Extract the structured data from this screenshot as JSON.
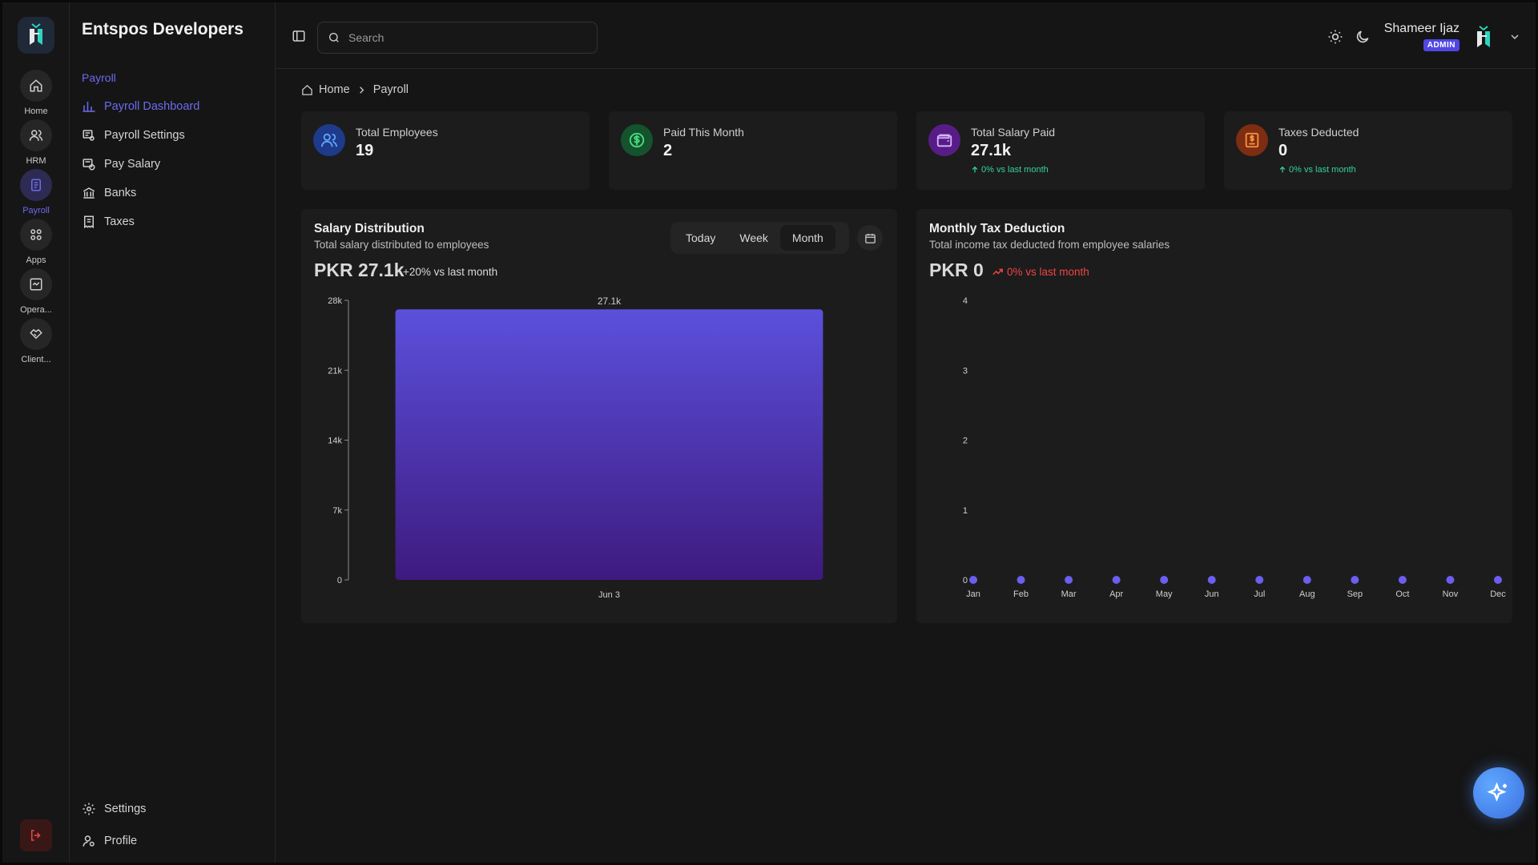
{
  "rail": {
    "items": [
      {
        "label": "Home",
        "icon": "home-icon"
      },
      {
        "label": "HRM",
        "icon": "users-icon"
      },
      {
        "label": "Payroll",
        "icon": "clipboard-icon"
      },
      {
        "label": "Apps",
        "icon": "grid-icon"
      },
      {
        "label": "Opera...",
        "icon": "operations-icon"
      },
      {
        "label": "Client...",
        "icon": "handshake-icon"
      }
    ]
  },
  "sidebar": {
    "org_name": "Entspos Developers",
    "section": "Payroll",
    "items": [
      {
        "label": "Payroll Dashboard",
        "icon": "bar-chart-icon"
      },
      {
        "label": "Payroll Settings",
        "icon": "settings-list-icon"
      },
      {
        "label": "Pay Salary",
        "icon": "pay-icon"
      },
      {
        "label": "Banks",
        "icon": "bank-icon"
      },
      {
        "label": "Taxes",
        "icon": "receipt-icon"
      }
    ],
    "footer": [
      {
        "label": "Settings",
        "icon": "gear-icon"
      },
      {
        "label": "Profile",
        "icon": "user-icon"
      }
    ]
  },
  "header": {
    "search_placeholder": "Search",
    "user_name": "Shameer Ijaz",
    "user_role": "ADMIN"
  },
  "breadcrumb": {
    "home": "Home",
    "current": "Payroll"
  },
  "stats": [
    {
      "label": "Total Employees",
      "value": "19",
      "trend": "",
      "color": "#3b82f6",
      "bg": "#1e3a8a",
      "icon": "users-icon"
    },
    {
      "label": "Paid This Month",
      "value": "2",
      "trend": "",
      "color": "#22c55e",
      "bg": "#14532d",
      "icon": "dollar-circle-icon"
    },
    {
      "label": "Total Salary Paid",
      "value": "27.1k",
      "trend": "0% vs last month",
      "color": "#c084fc",
      "bg": "#581c87",
      "icon": "wallet-icon"
    },
    {
      "label": "Taxes Deducted",
      "value": "0",
      "trend": "0% vs last month",
      "color": "#fb923c",
      "bg": "#7c2d12",
      "icon": "tax-doc-icon"
    }
  ],
  "salary": {
    "title": "Salary Distribution",
    "subtitle": "Total salary distributed to employees",
    "amount": "PKR 27.1k",
    "trend": "+20% vs last month",
    "ranges": [
      "Today",
      "Week",
      "Month"
    ],
    "active_range": "Month"
  },
  "tax": {
    "title": "Monthly Tax Deduction",
    "subtitle": "Total income tax deducted from employee salaries",
    "amount": "PKR 0",
    "trend": "0% vs last month",
    "trend_color": "#ef4444"
  },
  "chart_data": [
    {
      "type": "bar",
      "categories": [
        "Jun 3"
      ],
      "values": [
        27100
      ],
      "value_labels": [
        "27.1k"
      ],
      "ylim": [
        0,
        28000
      ],
      "yticks": [
        0,
        7000,
        14000,
        21000,
        28000
      ],
      "ytick_labels": [
        "0",
        "7k",
        "14k",
        "21k",
        "28k"
      ],
      "gradient": [
        "#5b50dc",
        "#3e1a7f"
      ]
    },
    {
      "type": "scatter",
      "categories": [
        "Jan",
        "Feb",
        "Mar",
        "Apr",
        "May",
        "Jun",
        "Jul",
        "Aug",
        "Sep",
        "Oct",
        "Nov",
        "Dec"
      ],
      "values": [
        0,
        0,
        0,
        0,
        0,
        0,
        0,
        0,
        0,
        0,
        0,
        0
      ],
      "ylim": [
        0,
        4
      ],
      "yticks": [
        0,
        1,
        2,
        3,
        4
      ],
      "ytick_labels": [
        "0",
        "1",
        "2",
        "3",
        "4"
      ],
      "color": "#6d5df0"
    }
  ]
}
